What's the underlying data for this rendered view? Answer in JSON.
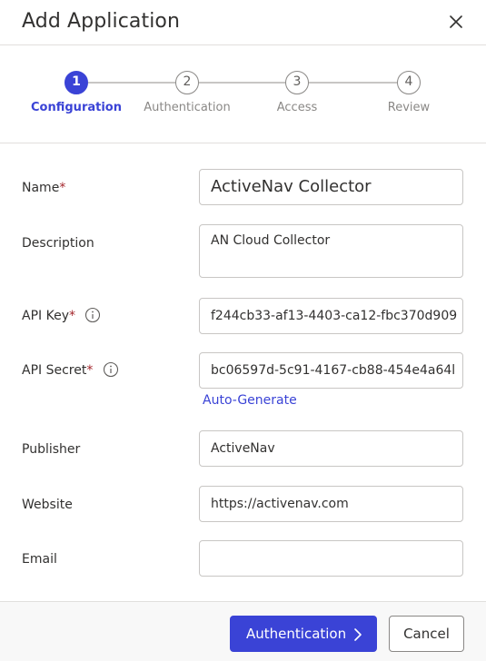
{
  "dialog": {
    "title": "Add Application",
    "close_icon": "close-icon"
  },
  "stepper": {
    "steps": [
      {
        "number": "1",
        "label": "Configuration",
        "active": true
      },
      {
        "number": "2",
        "label": "Authentication",
        "active": false
      },
      {
        "number": "3",
        "label": "Access",
        "active": false
      },
      {
        "number": "4",
        "label": "Review",
        "active": false
      }
    ],
    "active_color": "#3a43d6"
  },
  "form": {
    "name": {
      "label": "Name",
      "required_mark": "*",
      "value": "ActiveNav Collector"
    },
    "description": {
      "label": "Description",
      "value": "AN Cloud Collector"
    },
    "api_key": {
      "label": "API Key",
      "required_mark": "*",
      "info_icon": "info-icon",
      "value": "f244cb33-af13-4403-ca12-fbc370d909"
    },
    "api_secret": {
      "label": "API Secret",
      "required_mark": "*",
      "info_icon": "info-icon",
      "value": "bc06597d-5c91-4167-cb88-454e4a64l",
      "auto_generate_link": "Auto-Generate"
    },
    "publisher": {
      "label": "Publisher",
      "value": "ActiveNav"
    },
    "website": {
      "label": "Website",
      "value": "https://activenav.com"
    },
    "email": {
      "label": "Email",
      "value": ""
    }
  },
  "footer": {
    "primary_label": "Authentication",
    "primary_icon": "chevron-right-icon",
    "secondary_label": "Cancel"
  },
  "colors": {
    "accent": "#3a43d6",
    "required": "#a4262c"
  }
}
